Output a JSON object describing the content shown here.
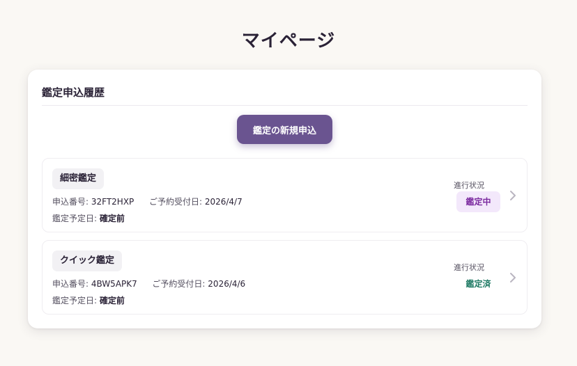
{
  "page": {
    "title": "マイページ"
  },
  "history": {
    "title": "鑑定申込履歴",
    "new_button_label": "鑑定の新規申込",
    "items": [
      {
        "type": "細密鑑定",
        "app_no_label": "申込番号:",
        "app_no": "32FT2HXP",
        "received_label": "ご予約受付日:",
        "received": "2026/4/7",
        "scheduled_label": "鑑定予定日:",
        "scheduled": "確定前",
        "status_caption": "進行状況",
        "status": "鑑定中"
      },
      {
        "type": "クイック鑑定",
        "app_no_label": "申込番号:",
        "app_no": "4BW5APK7",
        "received_label": "ご予約受付日:",
        "received": "2026/4/6",
        "scheduled_label": "鑑定予定日:",
        "scheduled": "確定前",
        "status_caption": "進行状況",
        "status": "鑑定済"
      }
    ]
  },
  "colors": {
    "accent": "#6a5490",
    "status_in_progress": "#7c2ba0",
    "status_done": "#1f7a64"
  },
  "icons": {
    "item_arrow": "chevron-right-icon"
  }
}
